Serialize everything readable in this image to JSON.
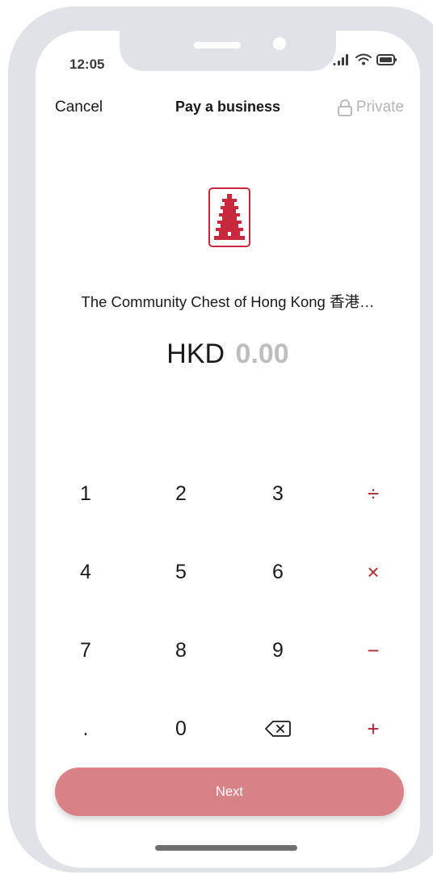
{
  "status_bar": {
    "time": "12:05",
    "signal_icon": "signal-bars-icon",
    "wifi_icon": "wifi-icon",
    "battery_icon": "battery-icon"
  },
  "nav": {
    "cancel_label": "Cancel",
    "title": "Pay a business",
    "private_label": "Private",
    "private_icon": "lock-icon"
  },
  "merchant": {
    "name": "The Community Chest of Hong Kong 香港…",
    "logo_icon": "pagoda-logo-icon"
  },
  "amount": {
    "currency": "HKD",
    "value": "0.00"
  },
  "keypad": {
    "rows": [
      [
        "1",
        "2",
        "3",
        "÷"
      ],
      [
        "4",
        "5",
        "6",
        "×"
      ],
      [
        "7",
        "8",
        "9",
        "−"
      ],
      [
        ".",
        "0",
        "",
        "+"
      ]
    ],
    "backspace_icon": "backspace-icon"
  },
  "next_label": "Next",
  "colors": {
    "accent": "#a82b34",
    "next_button": "#d98286",
    "frame": "#dfe3e8",
    "muted_text": "#b3b3b3"
  }
}
